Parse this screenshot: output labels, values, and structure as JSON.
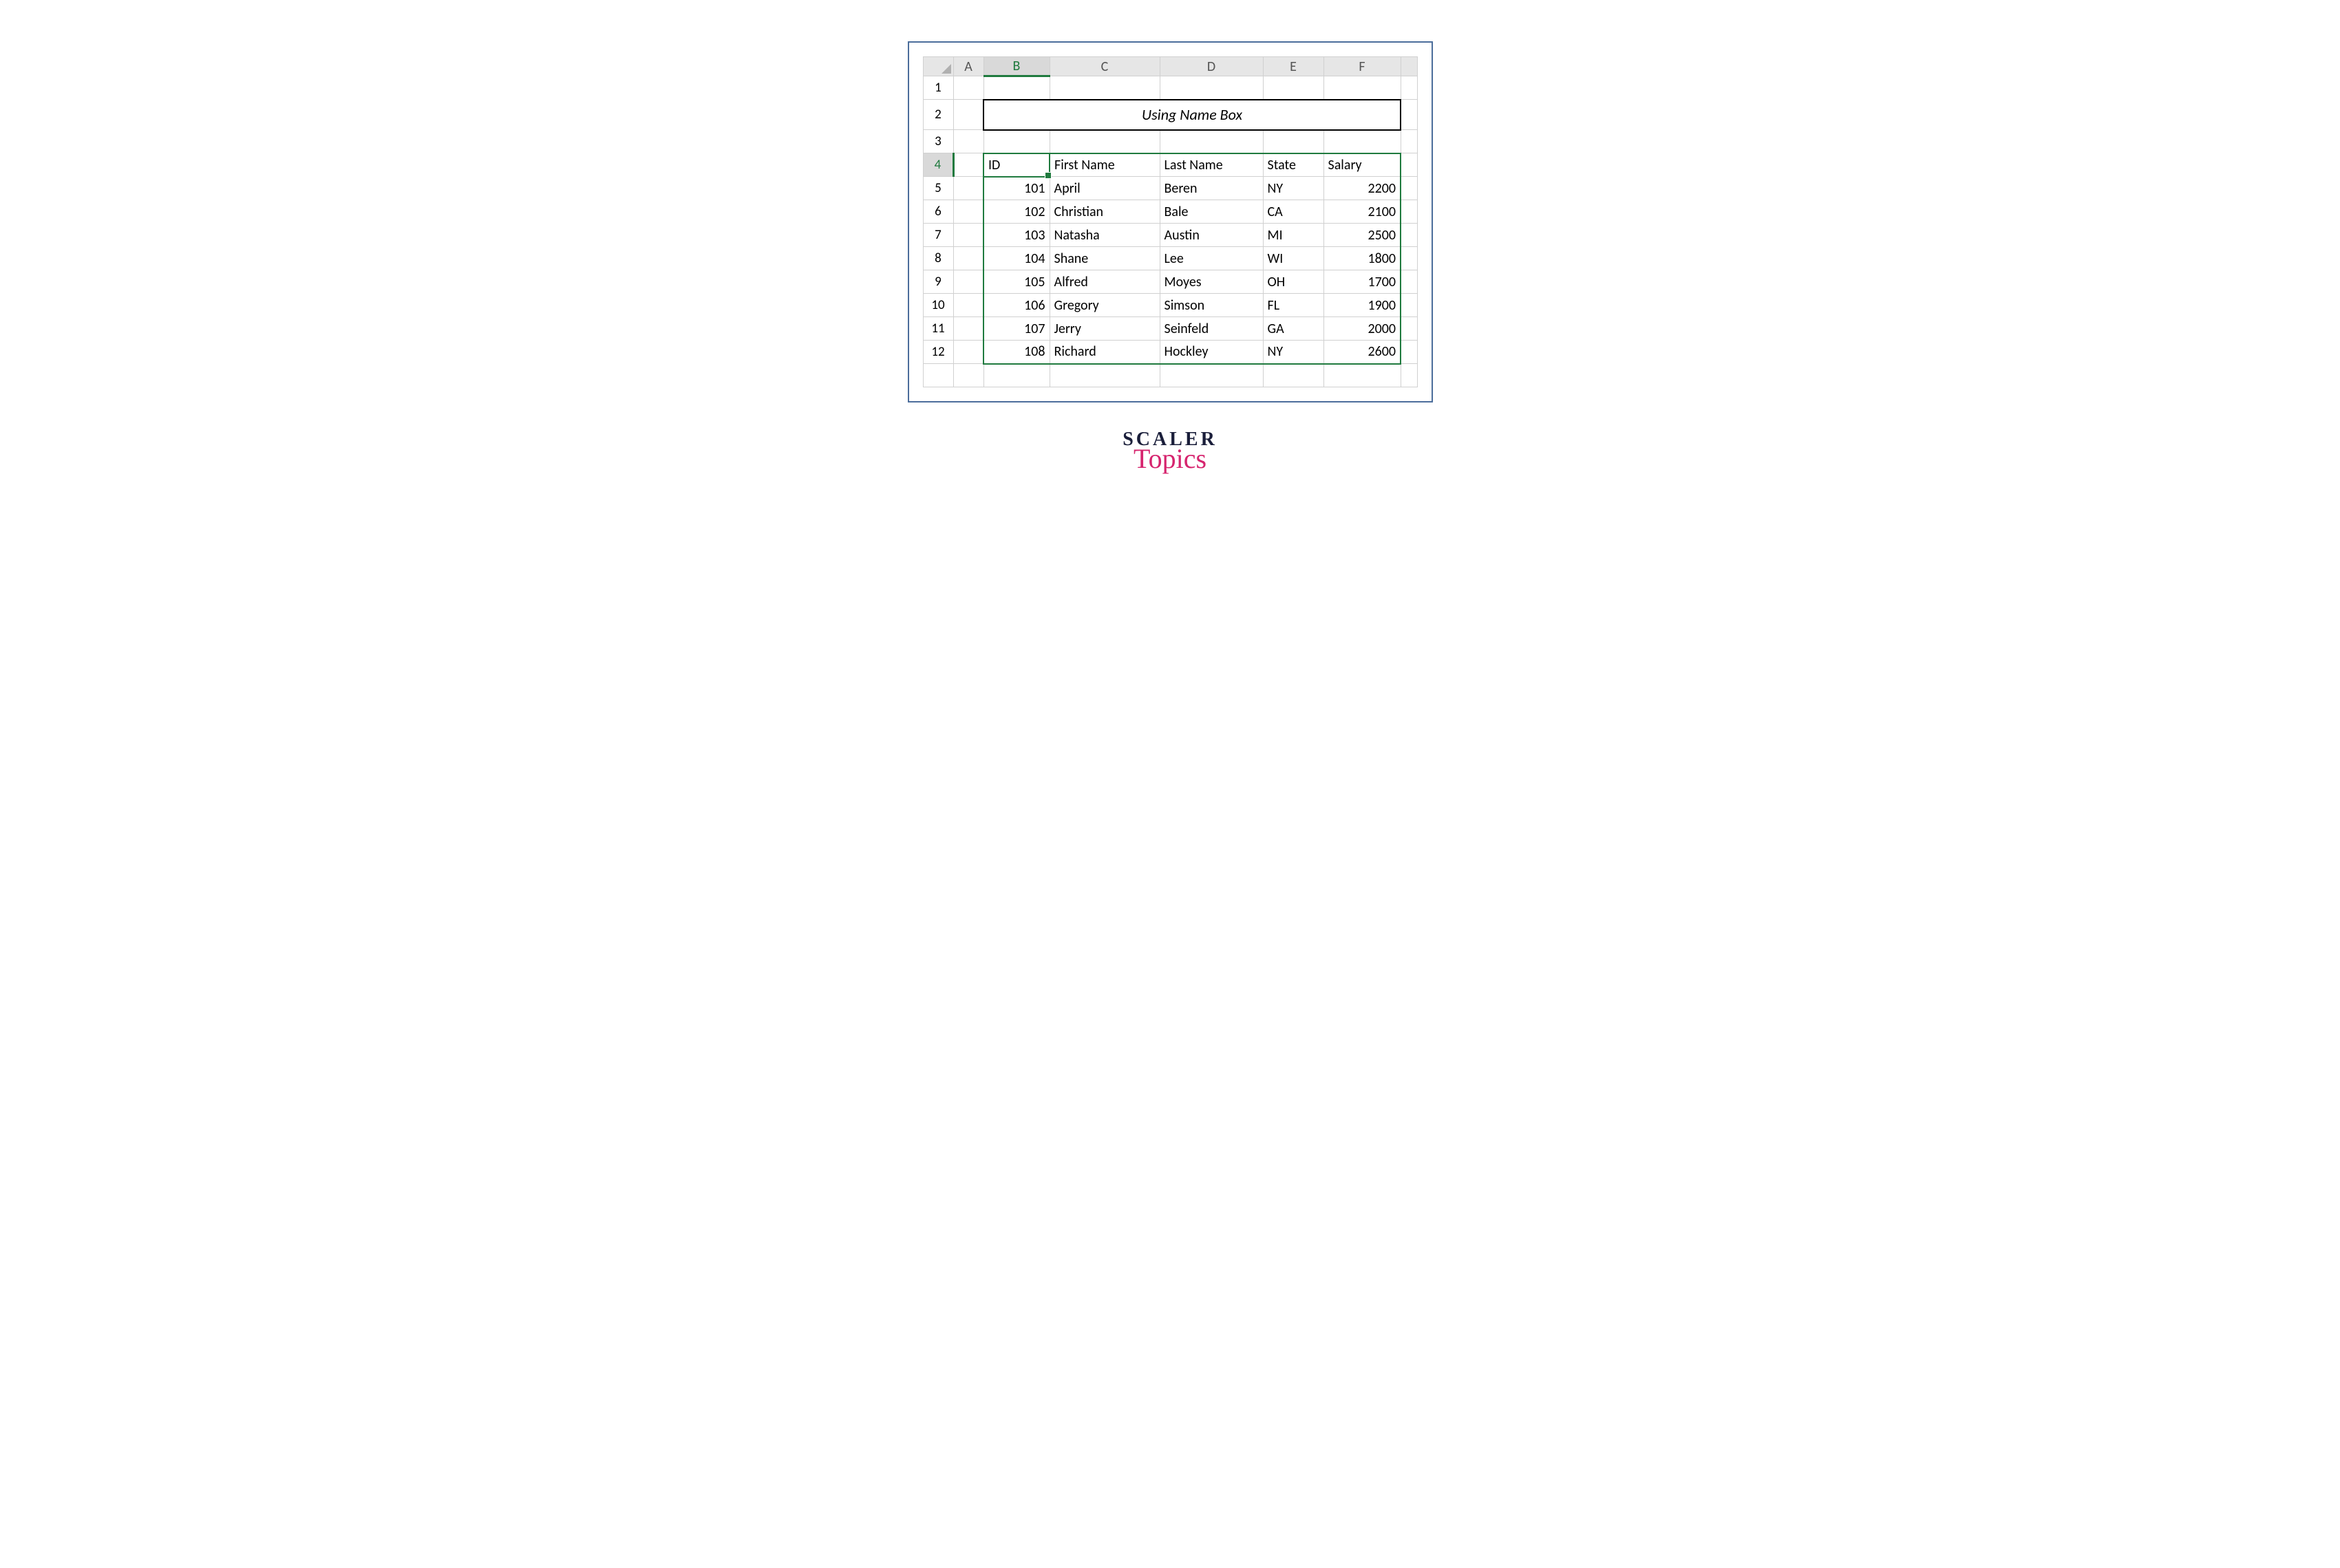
{
  "columns": {
    "A": "A",
    "B": "B",
    "C": "C",
    "D": "D",
    "E": "E",
    "F": "F"
  },
  "rows": {
    "r1": "1",
    "r2": "2",
    "r3": "3",
    "r4": "4",
    "r5": "5",
    "r6": "6",
    "r7": "7",
    "r8": "8",
    "r9": "9",
    "r10": "10",
    "r11": "11",
    "r12": "12"
  },
  "title_banner": "Using Name Box",
  "headers": {
    "id": "ID",
    "first_name": "First Name",
    "last_name": "Last Name",
    "state": "State",
    "salary": "Salary"
  },
  "data": [
    {
      "id": "101",
      "first_name": "April",
      "last_name": "Beren",
      "state": "NY",
      "salary": "2200"
    },
    {
      "id": "102",
      "first_name": "Christian",
      "last_name": "Bale",
      "state": "CA",
      "salary": "2100"
    },
    {
      "id": "103",
      "first_name": "Natasha",
      "last_name": "Austin",
      "state": "MI",
      "salary": "2500"
    },
    {
      "id": "104",
      "first_name": "Shane",
      "last_name": "Lee",
      "state": "WI",
      "salary": "1800"
    },
    {
      "id": "105",
      "first_name": "Alfred",
      "last_name": "Moyes",
      "state": "OH",
      "salary": "1700"
    },
    {
      "id": "106",
      "first_name": "Gregory",
      "last_name": "Simson",
      "state": "FL",
      "salary": "1900"
    },
    {
      "id": "107",
      "first_name": "Jerry",
      "last_name": "Seinfeld",
      "state": "GA",
      "salary": "2000"
    },
    {
      "id": "108",
      "first_name": "Richard",
      "last_name": "Hockley",
      "state": "NY",
      "salary": "2600"
    }
  ],
  "brand": {
    "line1": "SCALER",
    "line2": "Topics"
  },
  "chart_data": {
    "type": "table",
    "title": "Using Name Box",
    "columns": [
      "ID",
      "First Name",
      "Last Name",
      "State",
      "Salary"
    ],
    "rows": [
      [
        101,
        "April",
        "Beren",
        "NY",
        2200
      ],
      [
        102,
        "Christian",
        "Bale",
        "CA",
        2100
      ],
      [
        103,
        "Natasha",
        "Austin",
        "MI",
        2500
      ],
      [
        104,
        "Shane",
        "Lee",
        "WI",
        1800
      ],
      [
        105,
        "Alfred",
        "Moyes",
        "OH",
        1700
      ],
      [
        106,
        "Gregory",
        "Simson",
        "FL",
        1900
      ],
      [
        107,
        "Jerry",
        "Seinfeld",
        "GA",
        2000
      ],
      [
        108,
        "Richard",
        "Hockley",
        "NY",
        2600
      ]
    ]
  }
}
